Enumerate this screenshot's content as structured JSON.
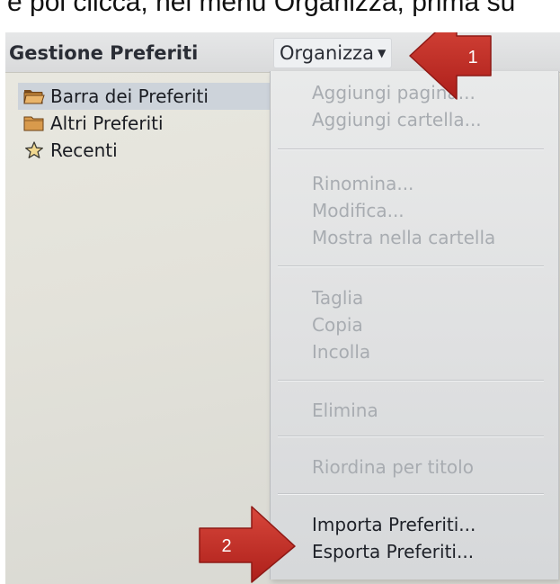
{
  "caption": {
    "text": "e poi clicca, nel menu Organizza, prima su"
  },
  "toolbar": {
    "title": "Gestione Preferiti",
    "organize_label": "Organizza"
  },
  "sidebar": {
    "items": [
      {
        "label": "Barra dei Preferiti",
        "icon": "open-folder-icon",
        "selected": true
      },
      {
        "label": "Altri Preferiti",
        "icon": "folder-icon",
        "selected": false
      },
      {
        "label": "Recenti",
        "icon": "star-icon",
        "selected": false
      }
    ]
  },
  "menu": {
    "items": [
      {
        "label": "Aggiungi pagina...",
        "enabled": false
      },
      {
        "label": "Aggiungi cartella...",
        "enabled": false
      },
      {
        "label": "Rinomina...",
        "enabled": false
      },
      {
        "label": "Modifica...",
        "enabled": false
      },
      {
        "label": "Mostra nella cartella",
        "enabled": false
      },
      {
        "label": "Taglia",
        "enabled": false
      },
      {
        "label": "Copia",
        "enabled": false
      },
      {
        "label": "Incolla",
        "enabled": false
      },
      {
        "label": "Elimina",
        "enabled": false
      },
      {
        "label": "Riordina per titolo",
        "enabled": false
      },
      {
        "label": "Importa Preferiti...",
        "enabled": true
      },
      {
        "label": "Esporta Preferiti...",
        "enabled": true
      }
    ]
  },
  "callouts": [
    {
      "number": "1",
      "color": "#c62d26"
    },
    {
      "number": "2",
      "color": "#c62d26"
    }
  ]
}
